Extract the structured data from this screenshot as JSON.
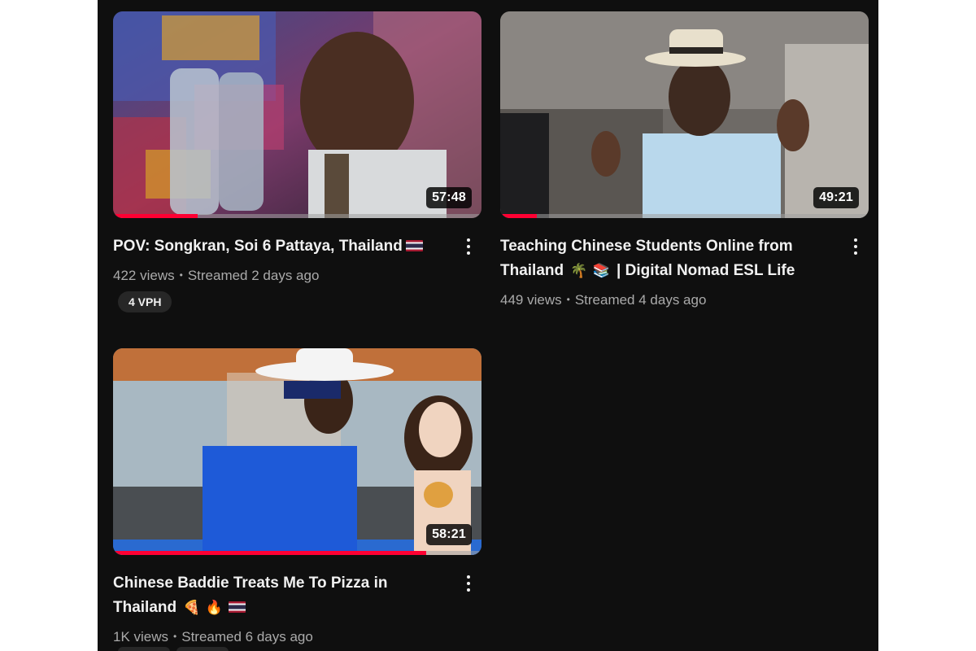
{
  "videos": [
    {
      "title": "POV: Songkran, Soi 6 Pattaya, Thailand",
      "views": "422 views",
      "streamed": "Streamed 2 days ago",
      "duration": "57:48",
      "badge": "4 VPH",
      "watch_progress": 0.23,
      "emoji": [
        "flag-thailand"
      ]
    },
    {
      "title_line1": "Teaching Chinese Students Online from",
      "title_line2": "| Digital Nomad ESL Life",
      "title_line2_prefix": "Thailand",
      "views": "449 views",
      "streamed": "Streamed 4 days ago",
      "duration": "49:21",
      "watch_progress": 0.1,
      "emoji": [
        "palm-tree",
        "books"
      ]
    },
    {
      "title_line1": "Chinese Baddie Treats Me To Pizza in",
      "title_line2": "Thailand",
      "views": "1K views",
      "streamed": "Streamed 6 days ago",
      "duration": "58:21",
      "watch_progress": 0.85,
      "emoji": [
        "pizza",
        "fire",
        "flag-thailand"
      ]
    }
  ],
  "colors": {
    "background": "#0f0f0f",
    "title": "#f1f1f1",
    "meta": "#aaaaaa",
    "progress": "#ff0033",
    "badge_bg": "#272727"
  }
}
